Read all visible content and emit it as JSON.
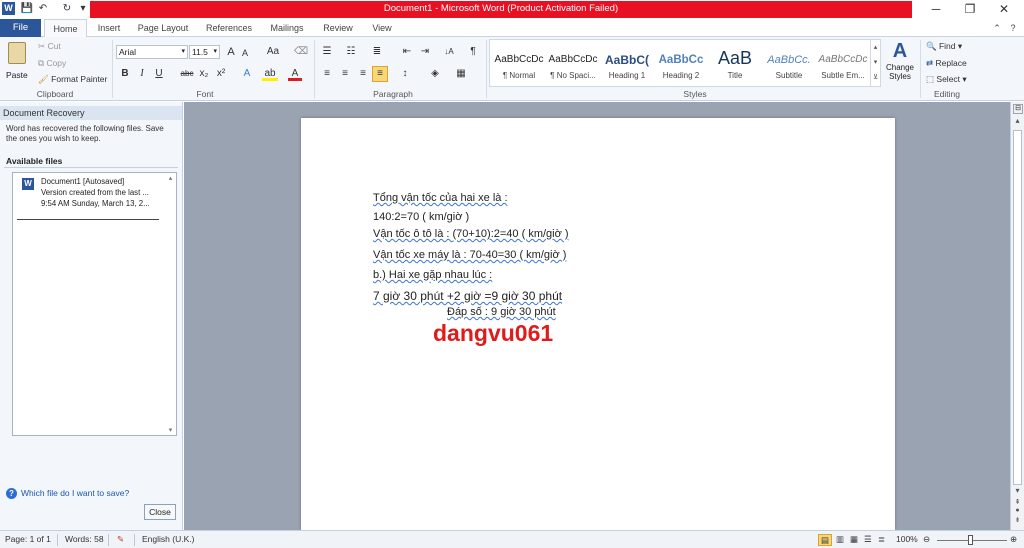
{
  "window": {
    "title": "Document1 - Microsoft Word (Product Activation Failed)",
    "app_icon": "W",
    "minimize": "─",
    "restore": "❐",
    "close": "✕"
  },
  "quick_access": {
    "save": "💾",
    "undo": "↶",
    "redo": "↻",
    "more": "▾"
  },
  "tabs": {
    "file": "File",
    "items": [
      "Home",
      "Insert",
      "Page Layout",
      "References",
      "Mailings",
      "Review",
      "View"
    ],
    "active": "Home",
    "minimize_ribbon": "⌃",
    "help": "?"
  },
  "clipboard": {
    "paste": "Paste",
    "cut": "Cut",
    "copy": "Copy",
    "format_painter": "Format Painter",
    "label": "Clipboard"
  },
  "font": {
    "name": "Arial",
    "size": "11.5",
    "label": "Font",
    "grow": "A",
    "shrink": "A",
    "case": "Aa",
    "bold": "B",
    "italic": "I",
    "underline": "U",
    "strike": "abc",
    "sub": "x₂",
    "sup": "x²",
    "effects": "A",
    "highlight": "ab",
    "color": "A"
  },
  "paragraph": {
    "label": "Paragraph",
    "pilcrow": "¶",
    "sort": "↓A"
  },
  "styles": {
    "label": "Styles",
    "items": [
      {
        "preview": "AaBbCcDc",
        "name": "¶ Normal"
      },
      {
        "preview": "AaBbCcDc",
        "name": "¶ No Spaci..."
      },
      {
        "preview": "AaBbC(",
        "name": "Heading 1"
      },
      {
        "preview": "AaBbCc",
        "name": "Heading 2"
      },
      {
        "preview": "AaB",
        "name": "Title"
      },
      {
        "preview": "AaBbCc.",
        "name": "Subtitle"
      },
      {
        "preview": "AaBbCcDc",
        "name": "Subtle Em..."
      }
    ],
    "change_styles": "Change Styles"
  },
  "editing": {
    "label": "Editing",
    "find": "Find",
    "replace": "Replace",
    "select": "Select"
  },
  "recovery_pane": {
    "title": "Document Recovery",
    "message": "Word has recovered the following files.  Save the ones you wish to keep.",
    "available_files": "Available files",
    "file": {
      "name": "Document1  [Autosaved]",
      "line2": "Version created from the last ...",
      "line3": "9:54 AM Sunday, March 13, 2..."
    },
    "help_link": "Which file do I want to save?",
    "close": "Close"
  },
  "document": {
    "lines": [
      "Tổng vận tốc của hai xe là :",
      "140:2=70 ( km/giờ )",
      "Vận tốc ô tô là : (70+10):2=40 ( km/giờ )",
      "Vận tốc xe máy là : 70-40=30 ( km/giờ )",
      "b.) Hai xe gặp nhau lúc :",
      "7 giờ 30 phút +2 giờ =9 giờ 30 phút",
      "Đáp số : 9 giờ 30 phút",
      "dangvu061"
    ]
  },
  "status": {
    "page": "Page: 1 of 1",
    "words": "Words: 58",
    "language": "English (U.K.)",
    "zoom": "100%"
  }
}
